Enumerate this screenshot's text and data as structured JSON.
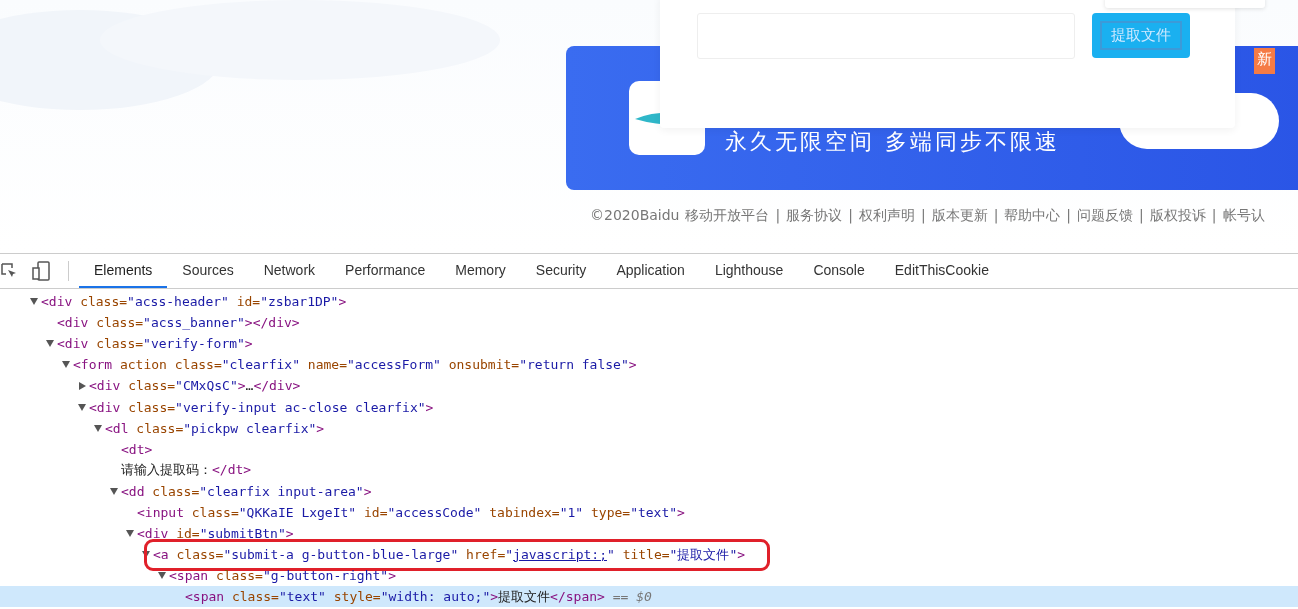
{
  "popup": {
    "button": "提取文件"
  },
  "banner": {
    "slogan": "永久无限空间 多端同步不限速",
    "badge": "新"
  },
  "footer": [
    "©2020Baidu",
    "移动开放平台",
    "|",
    "服务协议",
    "|",
    "权利声明",
    "|",
    "版本更新",
    "|",
    "帮助中心",
    "|",
    "问题反馈",
    "|",
    "版权投诉",
    "|",
    "帐号认"
  ],
  "devtools": {
    "tabs": [
      {
        "label": "Elements",
        "selected": true
      },
      {
        "label": "Sources",
        "selected": false
      },
      {
        "label": "Network",
        "selected": false
      },
      {
        "label": "Performance",
        "selected": false
      },
      {
        "label": "Memory",
        "selected": false
      },
      {
        "label": "Security",
        "selected": false
      },
      {
        "label": "Application",
        "selected": false
      },
      {
        "label": "Lighthouse",
        "selected": false
      },
      {
        "label": "Console",
        "selected": false
      },
      {
        "label": "EditThisCookie",
        "selected": false
      }
    ],
    "tree": [
      {
        "expanded": true,
        "selected": false,
        "boxed": false,
        "tokens": [
          {
            "kind": "tag",
            "s": "<div"
          },
          {
            "kind": "attr",
            "s": " class="
          },
          {
            "kind": "value",
            "s": "\"acss-header\""
          },
          {
            "kind": "attr",
            "s": " id="
          },
          {
            "kind": "value",
            "s": "\"zsbar1DP\""
          },
          {
            "kind": "tag",
            "s": ">"
          }
        ],
        "children": [
          {
            "selected": false,
            "boxed": false,
            "tokens": [
              {
                "kind": "tag",
                "s": "<div"
              },
              {
                "kind": "attr",
                "s": " class="
              },
              {
                "kind": "value",
                "s": "\"acss_banner\""
              },
              {
                "kind": "tag",
                "s": "></div>"
              }
            ]
          },
          {
            "expanded": true,
            "selected": false,
            "boxed": false,
            "tokens": [
              {
                "kind": "tag",
                "s": "<div"
              },
              {
                "kind": "attr",
                "s": " class="
              },
              {
                "kind": "value",
                "s": "\"verify-form\""
              },
              {
                "kind": "tag",
                "s": ">"
              }
            ],
            "children": [
              {
                "expanded": true,
                "selected": false,
                "boxed": false,
                "tokens": [
                  {
                    "kind": "tag",
                    "s": "<form"
                  },
                  {
                    "kind": "attr",
                    "s": " action class="
                  },
                  {
                    "kind": "value",
                    "s": "\"clearfix\""
                  },
                  {
                    "kind": "attr",
                    "s": " name="
                  },
                  {
                    "kind": "value",
                    "s": "\"accessForm\""
                  },
                  {
                    "kind": "attr",
                    "s": " onsubmit="
                  },
                  {
                    "kind": "value",
                    "s": "\"return false\""
                  },
                  {
                    "kind": "tag",
                    "s": ">"
                  }
                ],
                "children": [
                  {
                    "expanded": false,
                    "selected": false,
                    "boxed": false,
                    "tokens": [
                      {
                        "kind": "tag",
                        "s": "<div"
                      },
                      {
                        "kind": "attr",
                        "s": " class="
                      },
                      {
                        "kind": "value",
                        "s": "\"CMxQsC\""
                      },
                      {
                        "kind": "tag",
                        "s": ">"
                      },
                      {
                        "kind": "text",
                        "s": "…"
                      },
                      {
                        "kind": "tag",
                        "s": "</div>"
                      }
                    ]
                  },
                  {
                    "expanded": true,
                    "selected": false,
                    "boxed": false,
                    "tokens": [
                      {
                        "kind": "tag",
                        "s": "<div"
                      },
                      {
                        "kind": "attr",
                        "s": " class="
                      },
                      {
                        "kind": "value",
                        "s": "\"verify-input ac-close clearfix\""
                      },
                      {
                        "kind": "tag",
                        "s": ">"
                      }
                    ],
                    "children": [
                      {
                        "expanded": true,
                        "selected": false,
                        "boxed": false,
                        "tokens": [
                          {
                            "kind": "tag",
                            "s": "<dl"
                          },
                          {
                            "kind": "attr",
                            "s": " class="
                          },
                          {
                            "kind": "value",
                            "s": "\"pickpw clearfix\""
                          },
                          {
                            "kind": "tag",
                            "s": ">"
                          }
                        ],
                        "children": [
                          {
                            "selected": false,
                            "boxed": false,
                            "tokens": [
                              {
                                "kind": "tag",
                                "s": "<dt>"
                              }
                            ]
                          },
                          {
                            "selected": false,
                            "boxed": false,
                            "tokens": [
                              {
                                "kind": "text",
                                "s": "请输入提取码："
                              },
                              {
                                "kind": "tag",
                                "s": "</dt>"
                              }
                            ]
                          },
                          {
                            "expanded": true,
                            "selected": false,
                            "boxed": false,
                            "tokens": [
                              {
                                "kind": "tag",
                                "s": "<dd"
                              },
                              {
                                "kind": "attr",
                                "s": " class="
                              },
                              {
                                "kind": "value",
                                "s": "\"clearfix input-area\""
                              },
                              {
                                "kind": "tag",
                                "s": ">"
                              }
                            ],
                            "children": [
                              {
                                "selected": false,
                                "boxed": false,
                                "tokens": [
                                  {
                                    "kind": "tag",
                                    "s": "<input"
                                  },
                                  {
                                    "kind": "attr",
                                    "s": " class="
                                  },
                                  {
                                    "kind": "value",
                                    "s": "\"QKKaIE LxgeIt\""
                                  },
                                  {
                                    "kind": "attr",
                                    "s": " id="
                                  },
                                  {
                                    "kind": "value",
                                    "s": "\"accessCode\""
                                  },
                                  {
                                    "kind": "attr",
                                    "s": " tabindex="
                                  },
                                  {
                                    "kind": "value",
                                    "s": "\"1\""
                                  },
                                  {
                                    "kind": "attr",
                                    "s": " type="
                                  },
                                  {
                                    "kind": "value",
                                    "s": "\"text\""
                                  },
                                  {
                                    "kind": "tag",
                                    "s": ">"
                                  }
                                ]
                              },
                              {
                                "expanded": true,
                                "selected": false,
                                "boxed": false,
                                "tokens": [
                                  {
                                    "kind": "tag",
                                    "s": "<div"
                                  },
                                  {
                                    "kind": "attr",
                                    "s": " id="
                                  },
                                  {
                                    "kind": "value",
                                    "s": "\"submitBtn\""
                                  },
                                  {
                                    "kind": "tag",
                                    "s": ">"
                                  }
                                ],
                                "children": [
                                  {
                                    "expanded": true,
                                    "selected": false,
                                    "boxed": true,
                                    "tokens": [
                                      {
                                        "kind": "tag",
                                        "s": "<a"
                                      },
                                      {
                                        "kind": "attr",
                                        "s": " class="
                                      },
                                      {
                                        "kind": "value",
                                        "s": "\"submit-a g-button-blue-large\""
                                      },
                                      {
                                        "kind": "attr",
                                        "s": " href="
                                      },
                                      {
                                        "kind": "value",
                                        "s": "\""
                                      },
                                      {
                                        "kind": "link",
                                        "s": "javascript:;"
                                      },
                                      {
                                        "kind": "value",
                                        "s": "\""
                                      },
                                      {
                                        "kind": "attr",
                                        "s": " title="
                                      },
                                      {
                                        "kind": "value",
                                        "s": "\"提取文件\""
                                      },
                                      {
                                        "kind": "tag",
                                        "s": ">"
                                      }
                                    ],
                                    "children": [
                                      {
                                        "expanded": true,
                                        "selected": false,
                                        "boxed": false,
                                        "tokens": [
                                          {
                                            "kind": "tag",
                                            "s": "<span"
                                          },
                                          {
                                            "kind": "attr",
                                            "s": " class="
                                          },
                                          {
                                            "kind": "value",
                                            "s": "\"g-button-right\""
                                          },
                                          {
                                            "kind": "tag",
                                            "s": ">"
                                          }
                                        ],
                                        "children": [
                                          {
                                            "selected": true,
                                            "boxed": false,
                                            "tokens": [
                                              {
                                                "kind": "tag",
                                                "s": "<span"
                                              },
                                              {
                                                "kind": "attr",
                                                "s": " class="
                                              },
                                              {
                                                "kind": "value",
                                                "s": "\"text\""
                                              },
                                              {
                                                "kind": "attr",
                                                "s": " style="
                                              },
                                              {
                                                "kind": "value",
                                                "s": "\"width: auto;\""
                                              },
                                              {
                                                "kind": "tag",
                                                "s": ">"
                                              },
                                              {
                                                "kind": "text",
                                                "s": "提取文件"
                                              },
                                              {
                                                "kind": "tag",
                                                "s": "</span>"
                                              },
                                              {
                                                "kind": "dollar",
                                                "s": " == $0"
                                              }
                                            ]
                                          }
                                        ]
                                      }
                                    ]
                                  }
                                ]
                              }
                            ]
                          }
                        ]
                      }
                    ]
                  }
                ]
              }
            ]
          }
        ]
      }
    ]
  }
}
